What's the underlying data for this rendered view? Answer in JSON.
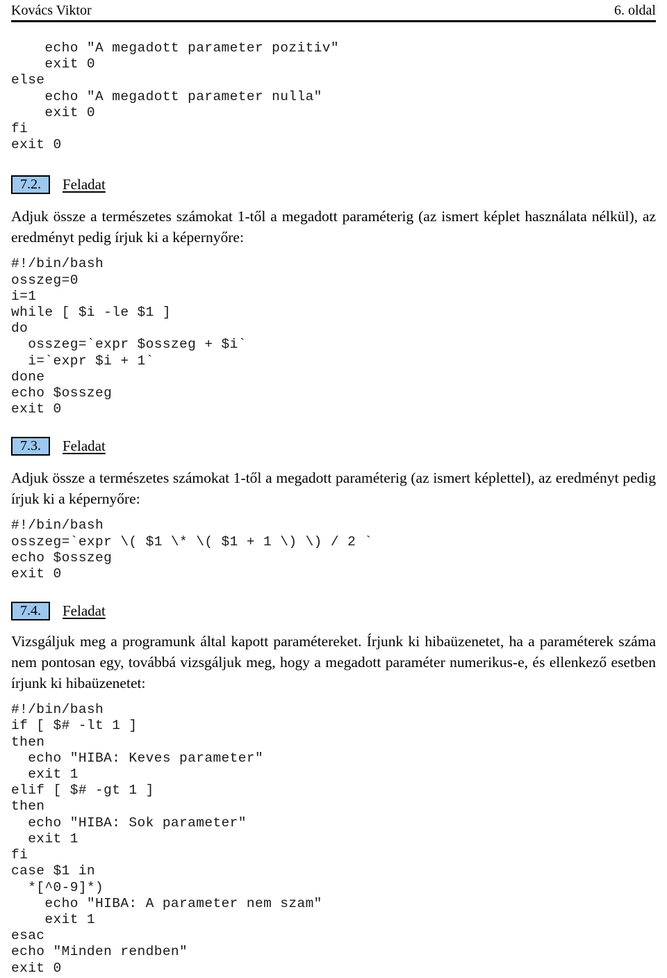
{
  "header": {
    "author": "Kovács Viktor",
    "folio": "6. oldal"
  },
  "top_code": "    echo \"A megadott parameter pozitiv\"\n    exit 0\nelse\n    echo \"A megadott parameter nulla\"\n    exit 0\nfi\nexit 0",
  "sections": [
    {
      "number": "7.2.",
      "title": "Feladat",
      "paragraph": "Adjuk össze a természetes számokat 1-től a megadott paraméterig (az ismert képlet használata nélkül), az eredményt pedig írjuk ki a képernyőre:",
      "code": "#!/bin/bash\nosszeg=0\ni=1\nwhile [ $i -le $1 ]\ndo\n  osszeg=`expr $osszeg + $i`\n  i=`expr $i + 1`\ndone\necho $osszeg\nexit 0"
    },
    {
      "number": "7.3.",
      "title": "Feladat",
      "paragraph": "Adjuk össze a természetes számokat 1-től a megadott paraméterig (az ismert képlettel), az eredményt pedig írjuk ki a képernyőre:",
      "code": "#!/bin/bash\nosszeg=`expr \\( $1 \\* \\( $1 + 1 \\) \\) / 2 `\necho $osszeg\nexit 0"
    },
    {
      "number": "7.4.",
      "title": "Feladat",
      "paragraph": "Vizsgáljuk meg a programunk által kapott paramétereket. Írjunk ki hibaüzenetet, ha a paraméterek száma nem pontosan egy, továbbá vizsgáljuk meg, hogy a megadott paraméter numerikus-e, és ellenkező esetben írjunk ki hibaüzenetet:",
      "code": "#!/bin/bash\nif [ $# -lt 1 ]\nthen\n  echo \"HIBA: Keves parameter\"\n  exit 1\nelif [ $# -gt 1 ]\nthen\n  echo \"HIBA: Sok parameter\"\n  exit 1\nfi\ncase $1 in\n  *[^0-9]*)\n    echo \"HIBA: A parameter nem szam\"\n    exit 1\nesac\necho \"Minden rendben\"\nexit 0"
    }
  ],
  "colors": {
    "section_badge_fill": "#9dc7ee",
    "section_badge_border": "#000000",
    "rule": "#000000",
    "text": "#000000"
  }
}
